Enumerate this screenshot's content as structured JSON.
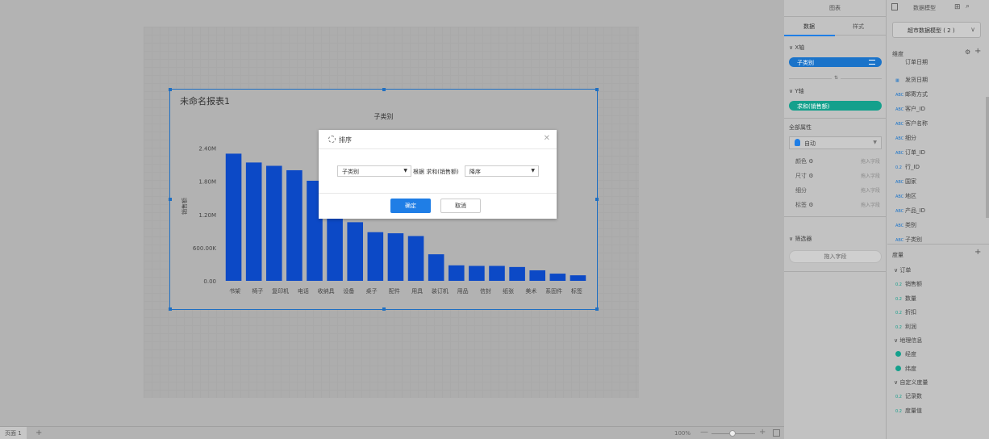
{
  "report": {
    "title": "未命名报表1",
    "subtitle": "子类别"
  },
  "chart_data": {
    "type": "bar",
    "title": "子类别",
    "xlabel": "",
    "ylabel": "销售额",
    "categories": [
      "书架",
      "椅子",
      "复印机",
      "电话",
      "收纳具",
      "设备",
      "桌子",
      "配件",
      "用具",
      "装订机",
      "用品",
      "信封",
      "纸张",
      "美术",
      "系固件",
      "标签"
    ],
    "values": [
      2300000,
      2140000,
      2080000,
      2000000,
      1810000,
      1490000,
      1060000,
      880000,
      860000,
      810000,
      480000,
      280000,
      270000,
      270000,
      250000,
      190000,
      130000,
      100000
    ],
    "ylim": [
      0,
      2700000
    ],
    "yticks": [
      "0.00",
      "600.00K",
      "1.20M",
      "1.80M",
      "2.40M"
    ],
    "grid": false,
    "bar_color": "#0c49c6"
  },
  "dialog": {
    "title": "排序",
    "field_value": "子类别",
    "basis_label": "根据 求和(销售额)",
    "order_value": "降序",
    "ok_label": "确定",
    "cancel_label": "取消"
  },
  "statusbar": {
    "page_tab": "页面 1",
    "add": "+",
    "zoom": "100%",
    "minus": "—",
    "plus": "+"
  },
  "panel": {
    "chart_header": "图表",
    "model_header": "数据模型",
    "tabs": [
      "数据",
      "样式"
    ],
    "x_axis_label": "X轴",
    "x_field": "子类别",
    "swap_glyph": "⇅",
    "y_axis_label": "Y轴",
    "y_field": "求和(销售额)",
    "all_props_label": "全部属性",
    "auto_label": "自动",
    "props": [
      {
        "name": "颜色",
        "hint": "拖入字段"
      },
      {
        "name": "尺寸",
        "hint": "拖入字段"
      },
      {
        "name": "细分",
        "hint": "拖入字段"
      },
      {
        "name": "标签",
        "hint": "拖入字段"
      }
    ],
    "filter_label": "筛选器",
    "drop_field": "拖入字段",
    "model_name": "超市数据模型 ( 2 )",
    "dimension_label": "维度",
    "dimensions": [
      {
        "ic": "",
        "name": "订单日期"
      },
      {
        "ic": "▦",
        "name": "发货日期"
      },
      {
        "ic": "ABC",
        "name": "邮寄方式"
      },
      {
        "ic": "ABC",
        "name": "客户_ID"
      },
      {
        "ic": "ABC",
        "name": "客户名称"
      },
      {
        "ic": "ABC",
        "name": "细分"
      },
      {
        "ic": "ABC",
        "name": "订单_ID"
      },
      {
        "ic": "0.2",
        "name": "行_ID"
      },
      {
        "ic": "ABC",
        "name": "国家"
      },
      {
        "ic": "ABC",
        "name": "地区"
      },
      {
        "ic": "ABC",
        "name": "产品_ID"
      },
      {
        "ic": "ABC",
        "name": "类别"
      },
      {
        "ic": "ABC",
        "name": "子类别"
      }
    ],
    "measure_label": "度量",
    "measure_groups": [
      {
        "name": "订单",
        "items": [
          "销售额",
          "数量",
          "折扣",
          "利润"
        ]
      },
      {
        "name": "地理信息",
        "items": [
          "经度",
          "纬度"
        ]
      },
      {
        "name": "自定义度量",
        "items": [
          "记录数",
          "度量值"
        ]
      }
    ]
  }
}
